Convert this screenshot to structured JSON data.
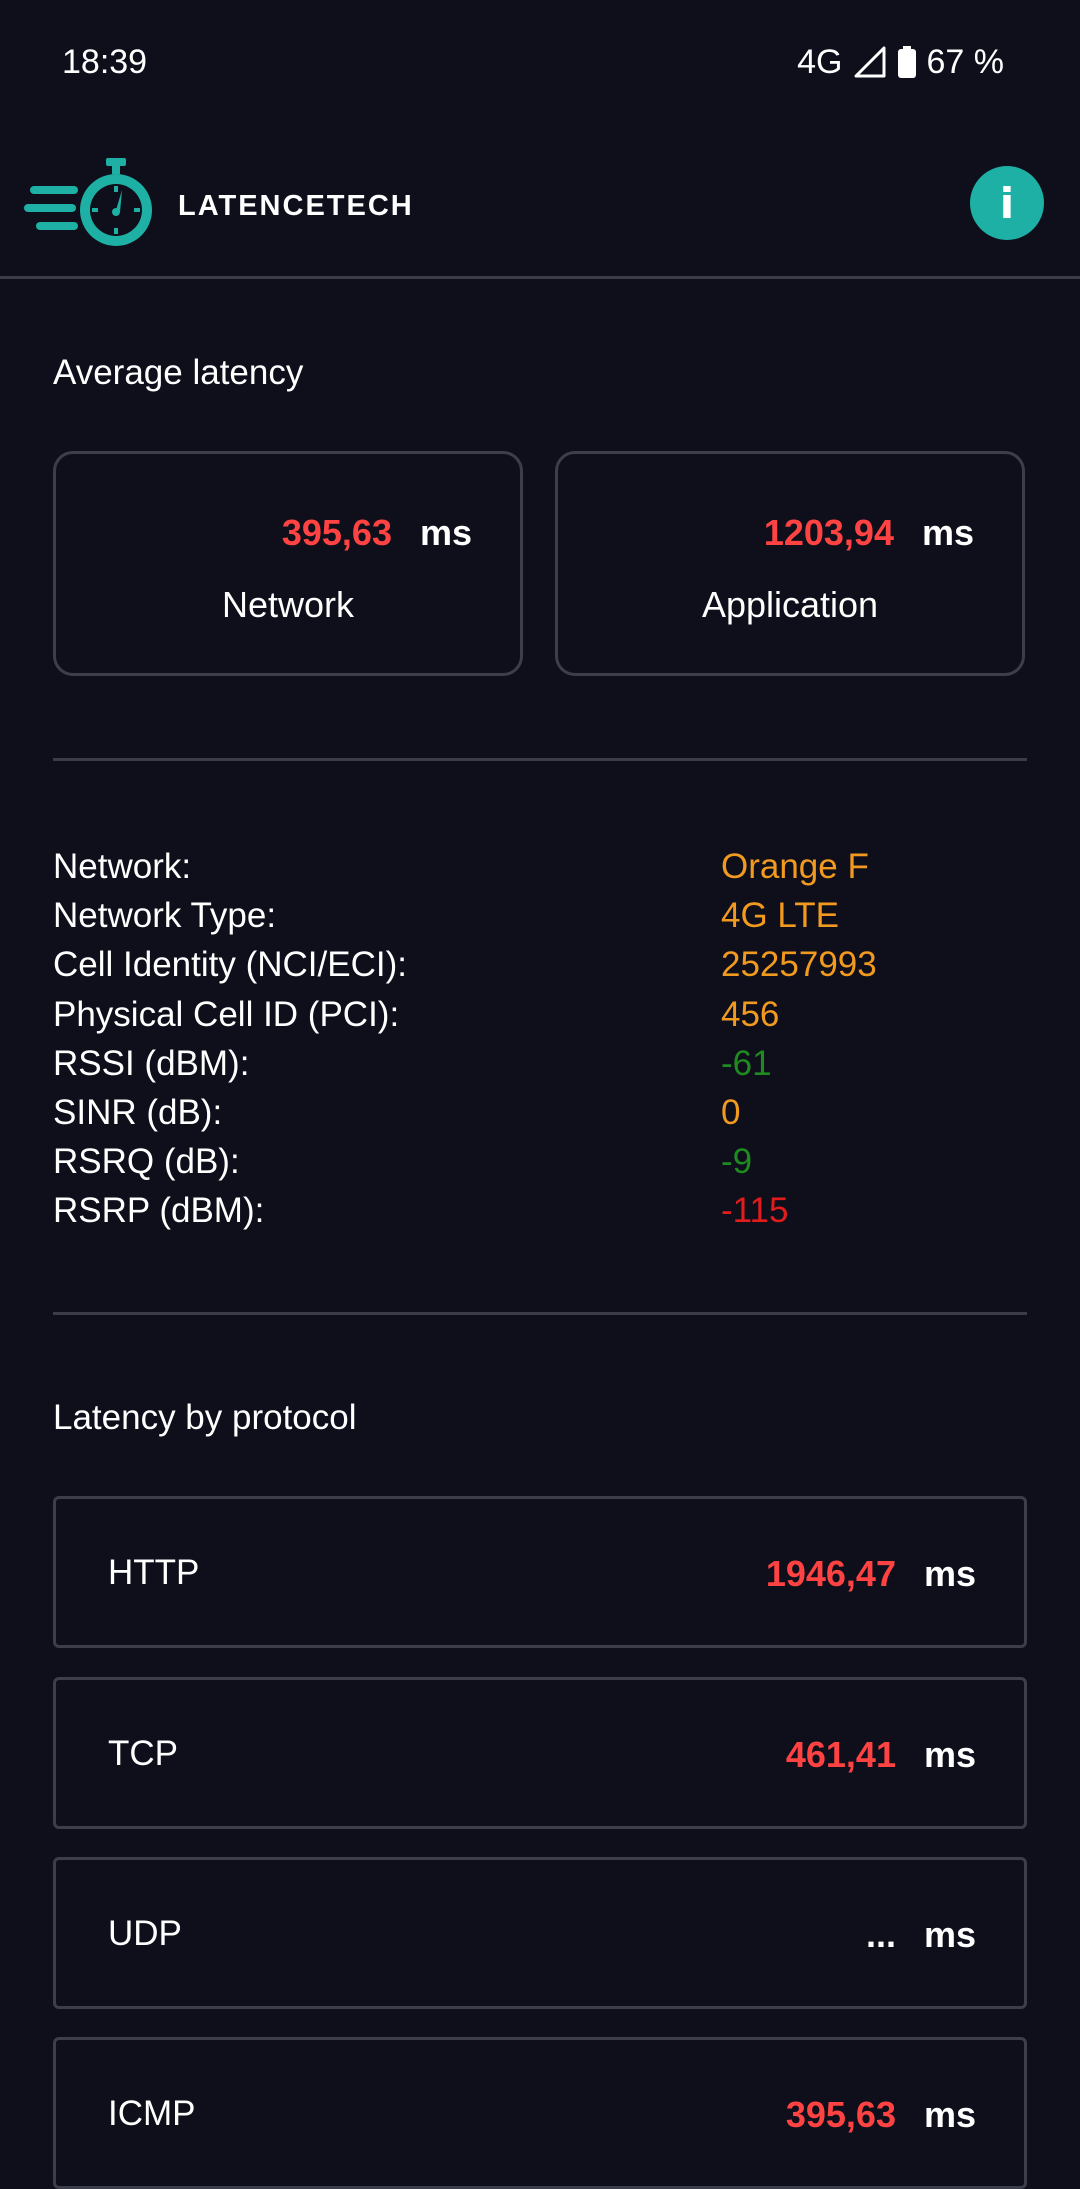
{
  "status_bar": {
    "time": "18:39",
    "network": "4G",
    "battery": "67 %"
  },
  "app_bar": {
    "brand": "LATENCETECH",
    "info_label": "i"
  },
  "average_latency": {
    "title": "Average latency",
    "cards": [
      {
        "value": "395,63",
        "unit": "ms",
        "label": "Network"
      },
      {
        "value": "1203,94",
        "unit": "ms",
        "label": "Application"
      }
    ]
  },
  "network_info": [
    {
      "label": "Network:",
      "value": "Orange F",
      "color": "#f29a1f"
    },
    {
      "label": "Network Type:",
      "value": "4G LTE",
      "color": "#f29a1f"
    },
    {
      "label": "Cell Identity (NCI/ECI):",
      "value": "25257993",
      "color": "#f29a1f"
    },
    {
      "label": "Physical Cell ID (PCI):",
      "value": "456",
      "color": "#f29a1f"
    },
    {
      "label": "RSSI (dBM):",
      "value": "-61",
      "color": "#1f8a1f"
    },
    {
      "label": "SINR (dB):",
      "value": "0",
      "color": "#f29a1f"
    },
    {
      "label": "RSRQ (dB):",
      "value": "-9",
      "color": "#1f8a1f"
    },
    {
      "label": "RSRP (dBM):",
      "value": "-115",
      "color": "#e21c1c"
    }
  ],
  "protocols": {
    "title": "Latency by protocol",
    "items": [
      {
        "name": "HTTP",
        "value": "1946,47",
        "unit": "ms"
      },
      {
        "name": "TCP",
        "value": "461,41",
        "unit": "ms"
      },
      {
        "name": "UDP",
        "value": "...",
        "unit": "ms"
      },
      {
        "name": "ICMP",
        "value": "395,63",
        "unit": "ms"
      }
    ]
  },
  "colors": {
    "background": "#0e0f1b",
    "accent": "#1eb0a4",
    "latency_value": "#ff4343"
  }
}
